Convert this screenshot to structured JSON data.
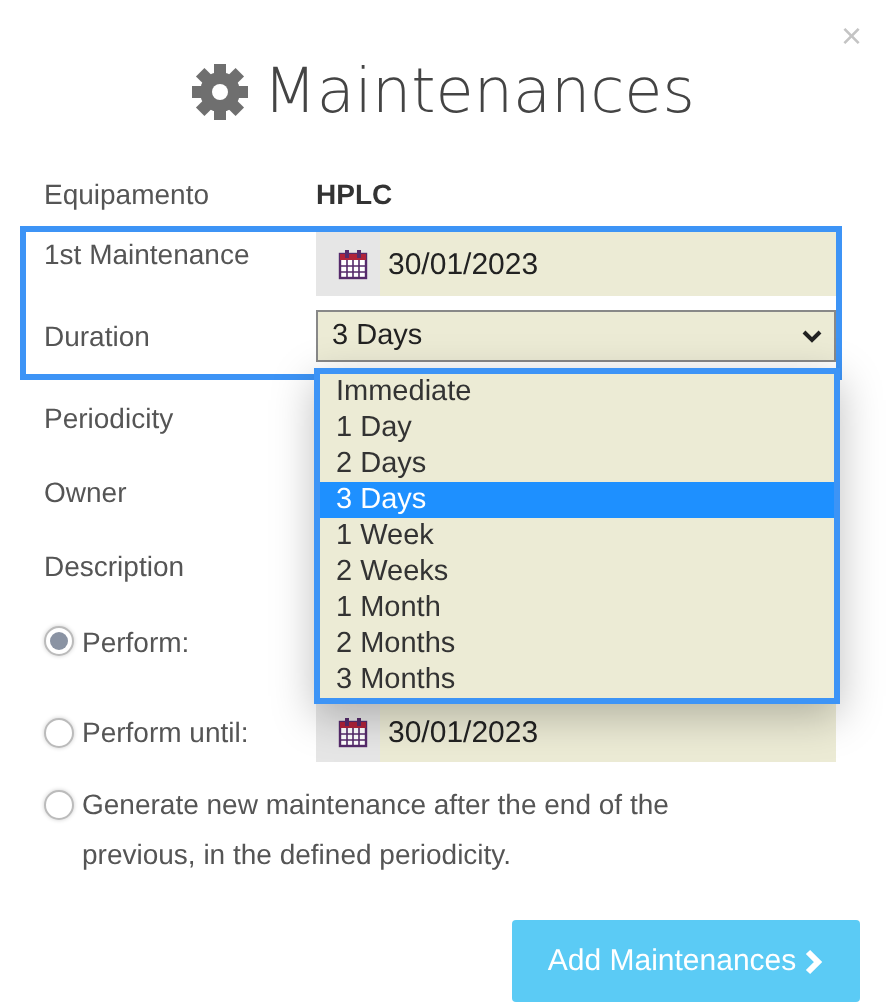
{
  "dialog": {
    "title": "Maintenances",
    "close": "×"
  },
  "equipment": {
    "label": "Equipamento",
    "value": "HPLC"
  },
  "first_maintenance": {
    "label": "1st Maintenance",
    "value": "30/01/2023"
  },
  "duration": {
    "label": "Duration",
    "value": "3 Days",
    "expanded": true,
    "options": [
      {
        "label": "Immediate",
        "selected": false
      },
      {
        "label": "1 Day",
        "selected": false
      },
      {
        "label": "2 Days",
        "selected": false
      },
      {
        "label": "3 Days",
        "selected": true
      },
      {
        "label": "1 Week",
        "selected": false
      },
      {
        "label": "2 Weeks",
        "selected": false
      },
      {
        "label": "1 Month",
        "selected": false
      },
      {
        "label": "2 Months",
        "selected": false
      },
      {
        "label": "3 Months",
        "selected": false
      }
    ]
  },
  "other_labels": [
    "Periodicity",
    "Owner",
    "Description"
  ],
  "schedule_options": [
    {
      "label": "Perform:",
      "selected": true,
      "kind": "short"
    },
    {
      "label": "Perform until:",
      "selected": false,
      "kind": "date",
      "value": "30/01/2023"
    },
    {
      "label": "Generate new maintenance after the end of the previous, in the defined periodicity.",
      "selected": false,
      "kind": "long"
    }
  ],
  "submit_button": "Add Maintenances"
}
